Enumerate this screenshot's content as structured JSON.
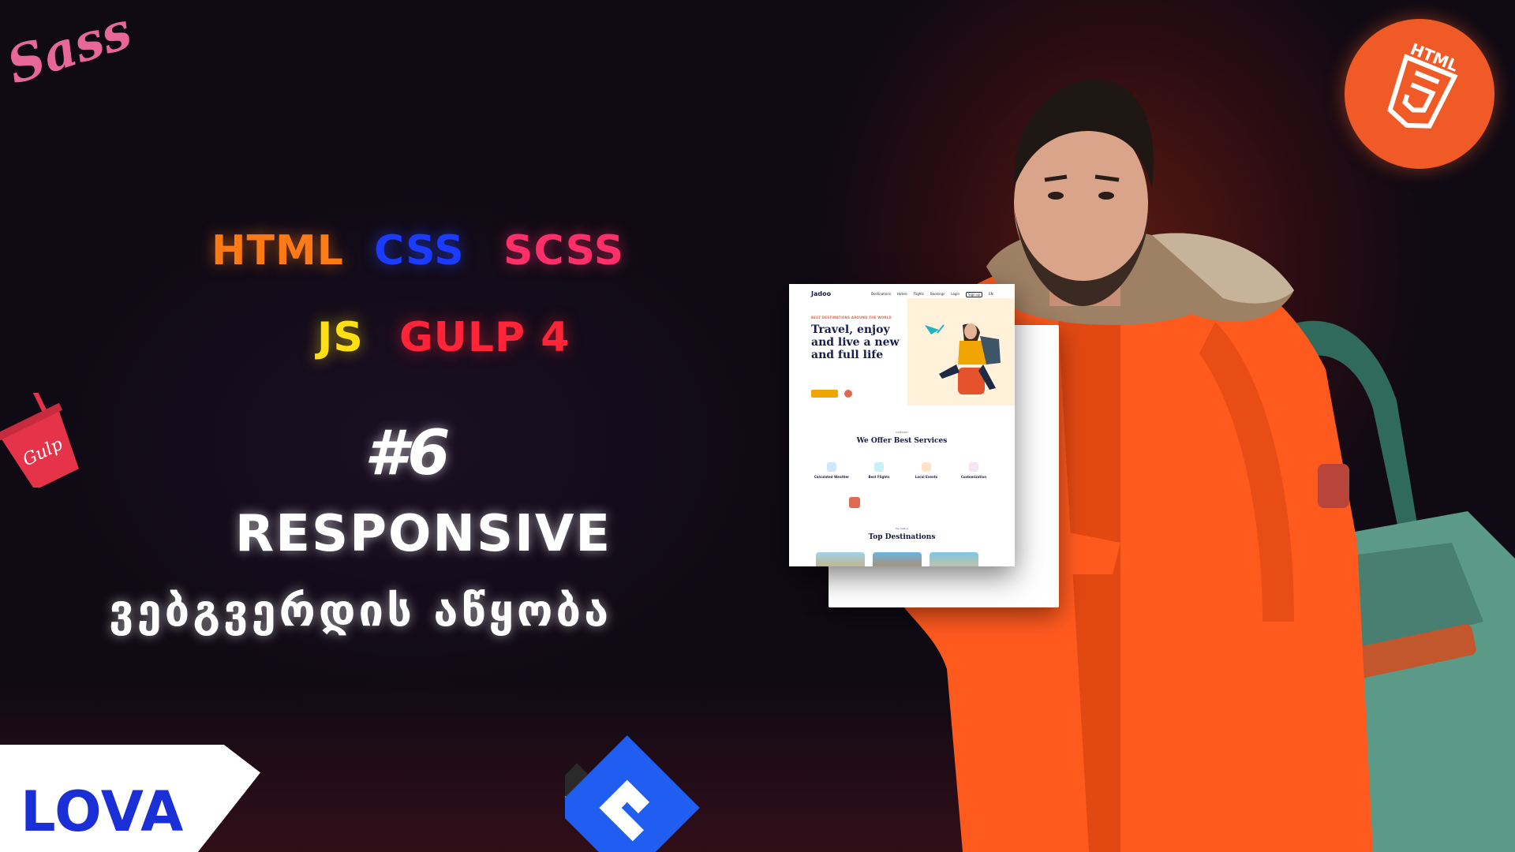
{
  "thumbnail": {
    "tech_tags": {
      "html": "HTML",
      "css": "CSS",
      "scss": "SCSS",
      "js": "JS",
      "gulp": "GULP 4"
    },
    "episode": "#6",
    "headline": "RESPONSIVE",
    "subline": "ვებგვერდის აწყობა",
    "brand": "LOVA",
    "logos": {
      "sass": "Sass",
      "html5": "HTML",
      "gulp": "Gulp"
    }
  },
  "mockup": {
    "logo": "Jadoo",
    "nav": [
      "Destinations",
      "Hotels",
      "Flights",
      "Bookings",
      "Login",
      "Sign up",
      "EN"
    ],
    "kicker": "BEST DESTINATIONS AROUND THE WORLD",
    "title": "Travel, enjoy and live a new and full life",
    "services_kicker": "CATEGORY",
    "services_title": "We Offer Best Services",
    "cards": [
      {
        "title": "Calculated Weather"
      },
      {
        "title": "Best Flights"
      },
      {
        "title": "Local Events"
      },
      {
        "title": "Customization"
      }
    ],
    "top_kicker": "Top Selling",
    "top_title": "Top Destinations"
  },
  "colors": {
    "html": "#ff7a14",
    "css": "#1b3cff",
    "scss": "#ff2f6a",
    "js": "#ffe012",
    "gulp": "#ff2437",
    "brand": "#1b2fd6",
    "html5_badge": "#ef5a26",
    "jacket": "#ff5a1e"
  }
}
